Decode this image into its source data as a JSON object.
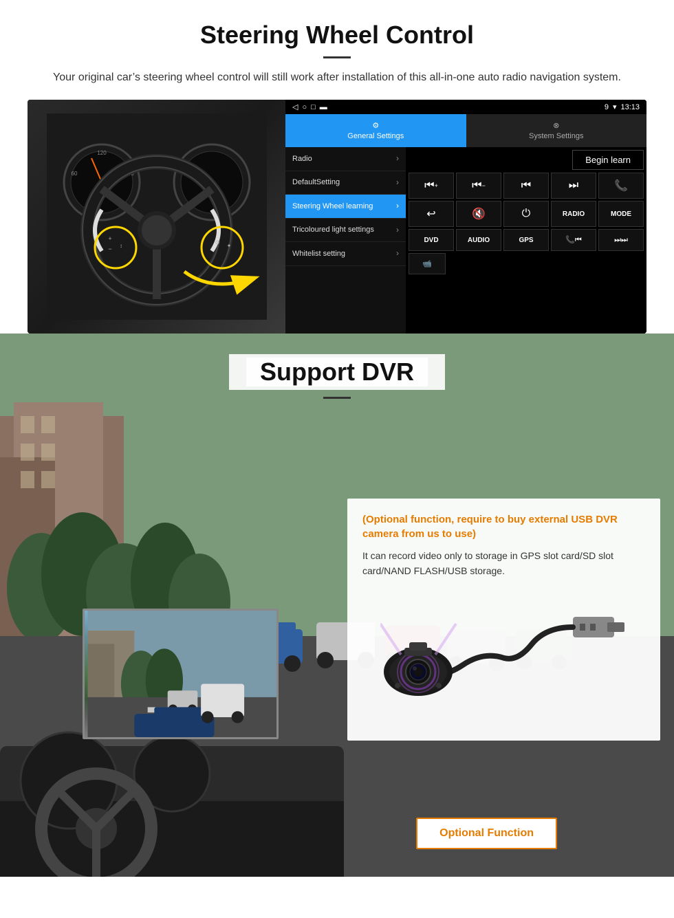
{
  "steering": {
    "title": "Steering Wheel Control",
    "subtitle": "Your original car’s steering wheel control will still work after installation of this all-in-one auto radio navigation system.",
    "statusbar": {
      "time": "13:13",
      "wifi": "▼",
      "signal": "9"
    },
    "tabs": {
      "general": "General Settings",
      "system": "System Settings"
    },
    "menu": {
      "items": [
        {
          "label": "Radio",
          "active": false
        },
        {
          "label": "DefaultSetting",
          "active": false
        },
        {
          "label": "Steering Wheel learning",
          "active": true
        },
        {
          "label": "Tricoloured light settings",
          "active": false
        },
        {
          "label": "Whitelist setting",
          "active": false
        }
      ]
    },
    "begin_learn": "Begin learn",
    "controls": {
      "row1": [
        "⏮+",
        "⏮−",
        "⏮⏮",
        "⏭⏭",
        "☎"
      ],
      "row2": [
        "↩",
        "🔇",
        "⏻",
        "RADIO",
        "MODE"
      ],
      "row3": [
        "DVD",
        "AUDIO",
        "GPS",
        "☎⏮",
        "⏭⏭"
      ]
    }
  },
  "dvr": {
    "title": "Support DVR",
    "optional_text": "(Optional function, require to buy external USB DVR camera from us to use)",
    "desc_text": "It can record video only to storage in GPS slot card/SD slot card/NAND FLASH/USB storage.",
    "button_label": "Optional Function"
  }
}
